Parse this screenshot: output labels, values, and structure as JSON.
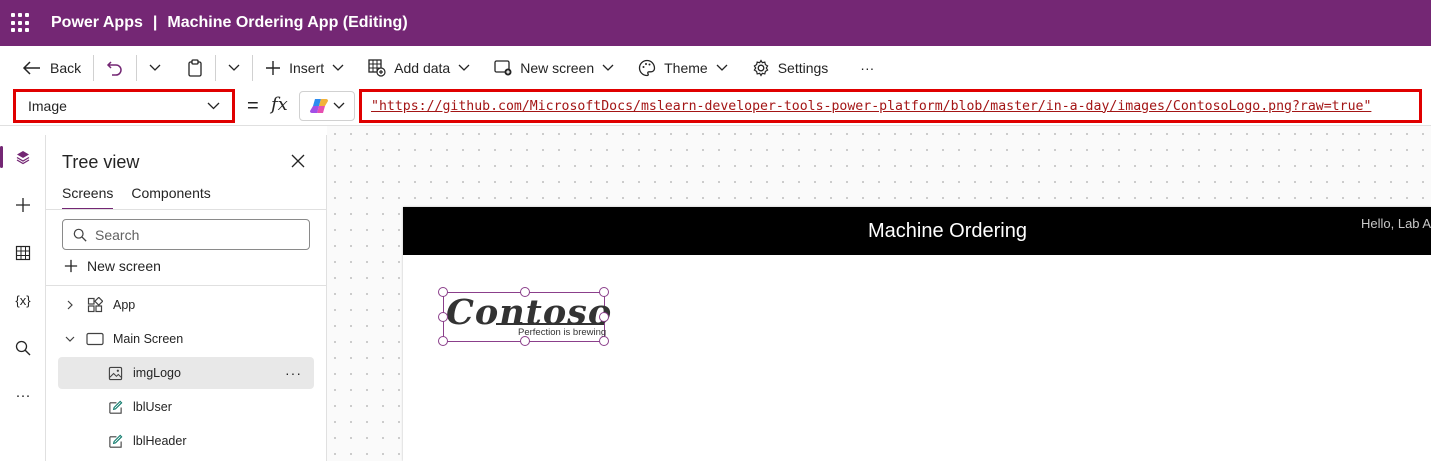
{
  "app": {
    "product": "Power Apps",
    "separator": "|",
    "title": "Machine Ordering App (Editing)"
  },
  "toolbar": {
    "back": "Back",
    "insert": "Insert",
    "add_data": "Add data",
    "new_screen": "New screen",
    "theme": "Theme",
    "settings": "Settings",
    "more": "···"
  },
  "formula_bar": {
    "property": "Image",
    "equals": "=",
    "fx": "fx",
    "formula": "\"https://github.com/MicrosoftDocs/mslearn-developer-tools-power-platform/blob/master/in-a-day/images/ContosoLogo.png?raw=true\""
  },
  "rail": {
    "icons": [
      "layers-icon",
      "plus-icon",
      "table-icon",
      "variables-icon",
      "search-icon",
      "more-icon"
    ],
    "variables_label": "{x}",
    "more_label": "···"
  },
  "tree_view": {
    "title": "Tree view",
    "tabs": [
      "Screens",
      "Components"
    ],
    "search_placeholder": "Search",
    "new_screen": "New screen",
    "nodes": [
      {
        "label": "App"
      },
      {
        "label": "Main Screen"
      },
      {
        "label": "imgLogo"
      },
      {
        "label": "lblUser"
      },
      {
        "label": "lblHeader"
      }
    ],
    "node_more": "···"
  },
  "canvas": {
    "header_title": "Machine Ordering",
    "user_label": "Hello, Lab A",
    "logo_text": "Contoso",
    "logo_tagline": "Perfection is brewing"
  },
  "colors": {
    "brand": "#742774",
    "highlight": "#e00000",
    "header_bg": "#000000"
  }
}
